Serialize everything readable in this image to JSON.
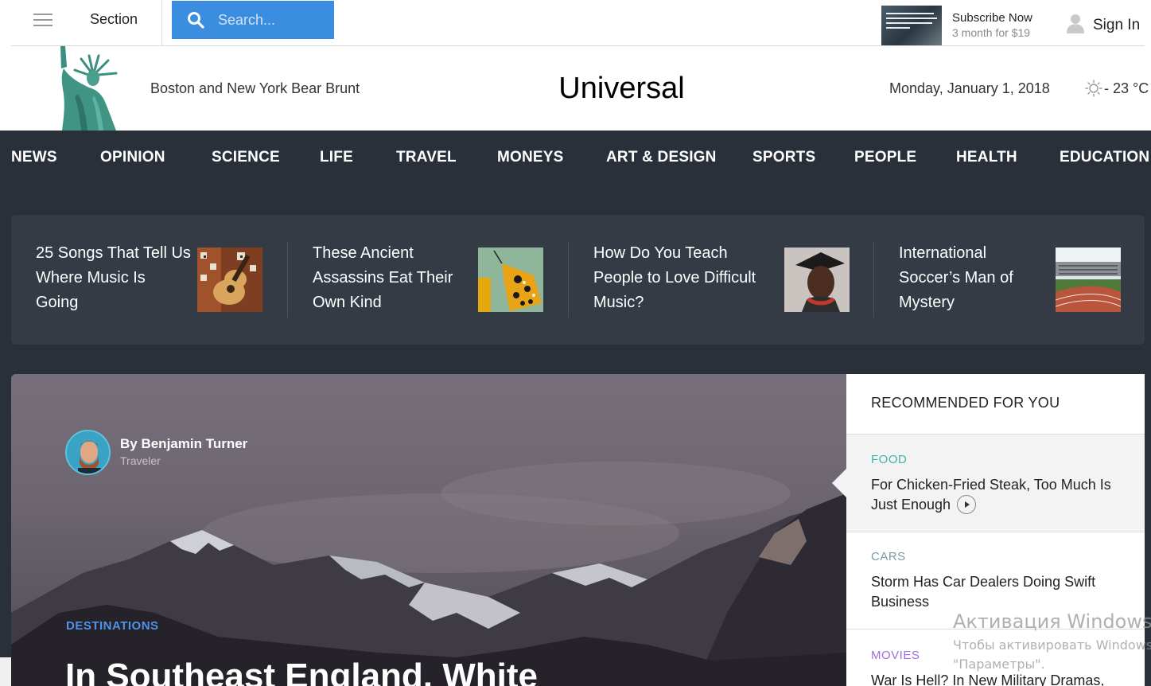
{
  "topbar": {
    "menu_icon": "hamburger-icon",
    "section_label": "Section",
    "search_icon": "search-icon",
    "search_placeholder": "Search...",
    "subscribe_title": "Subscribe Now",
    "subscribe_price": "3 month for $19",
    "user_icon": "user-icon",
    "signin_label": "Sign In"
  },
  "masthead": {
    "logo_icon": "statue-of-liberty-logo",
    "tagline": "Boston and New York Bear Brunt",
    "brand": "Universal",
    "date": "Monday, January 1, 2018",
    "weather_icon": "sun-icon",
    "temperature": "- 23 °C"
  },
  "nav": {
    "items": [
      "NEWS",
      "OPINION",
      "SCIENCE",
      "LIFE",
      "TRAVEL",
      "MONEYS",
      "ART & DESIGN",
      "SPORTS",
      "PEOPLE",
      "HEALTH",
      "EDUCATION"
    ]
  },
  "featured": [
    {
      "title": "25 Songs That Tell Us Where Music Is Going"
    },
    {
      "title": "These Ancient Assassins Eat Their Own Kind"
    },
    {
      "title": "How Do You Teach People to Love Difficult Music?"
    },
    {
      "title": "International Soccer’s Man of Mystery"
    }
  ],
  "hero": {
    "author_name": "By Benjamin Turner",
    "author_role": "Traveler",
    "category": "DESTINATIONS",
    "title": "In Southeast England, White"
  },
  "recommended": {
    "heading": "RECOMMENDED FOR YOU",
    "items": [
      {
        "category": "FOOD",
        "category_color": "#3fb3b0",
        "title": "For Chicken-Fried Steak, Too Much Is Just Enough"
      },
      {
        "category": "CARS",
        "category_color": "#7c9aa8",
        "title": "Storm Has Car Dealers Doing Swift Business"
      },
      {
        "category": "MOVIES",
        "category_color": "#a170d8",
        "title": "War Is Hell? In New Military Dramas,"
      }
    ]
  },
  "watermark": {
    "line1": "Активация Windows",
    "line2": "Чтобы активировать Windows",
    "line3": "\"Параметры\"."
  },
  "colors": {
    "dark_background": "#2a3039",
    "search_blue": "#3b8de0",
    "hero_category_blue": "#4f93ec"
  }
}
